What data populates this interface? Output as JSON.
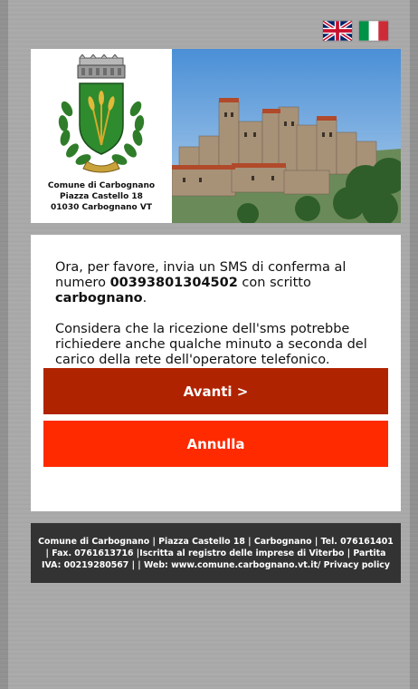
{
  "flags": [
    {
      "name": "english",
      "label": "English"
    },
    {
      "name": "italian",
      "label": "Italiano"
    }
  ],
  "header": {
    "address_line1": "Comune di Carbognano",
    "address_line2": "Piazza Castello 18",
    "address_line3": "01030 Carbognano VT"
  },
  "message": {
    "p1_before": "Ora, per favore, invia un SMS di conferma al numero ",
    "phone": "00393801304502",
    "p1_middle": " con scritto ",
    "keyword": "carbognano",
    "p1_end": ".",
    "p2": "Considera che la ricezione dell'sms potrebbe richiedere anche qualche minuto a seconda del carico della rete dell'operatore telefonico."
  },
  "buttons": {
    "next": "Avanti >",
    "cancel": "Annulla"
  },
  "footer": {
    "text": "Comune di Carbognano | Piazza Castello 18 | Carbognano | Tel. 076161401 | Fax. 0761613716 |Iscritta al registro delle imprese di Viterbo | Partita IVA: 00219280567 | | Web: www.comune.carbognano.vt.it/",
    "privacy_link": "Privacy policy"
  },
  "colors": {
    "next_button": "#b02300",
    "cancel_button": "#ff2a00",
    "footer_bg": "#333333"
  }
}
